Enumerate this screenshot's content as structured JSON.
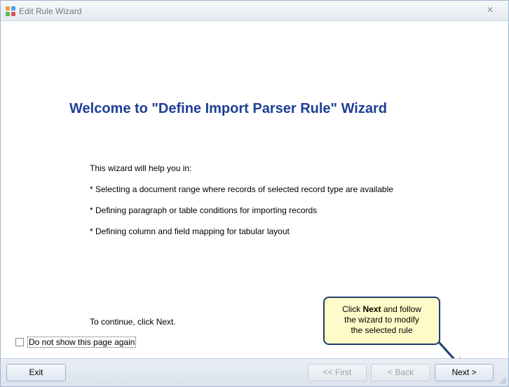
{
  "window": {
    "title": "Edit Rule Wizard",
    "close_glyph": "×"
  },
  "content": {
    "heading": "Welcome to \"Define Import Parser Rule\" Wizard",
    "intro": "This wizard will help you in:",
    "bullets": [
      "* Selecting a document range where records of selected record type are available",
      "* Defining paragraph or table conditions for importing records",
      "* Defining column and field mapping for tabular layout"
    ],
    "continue_text": "To continue, click Next.",
    "checkbox_label": "Do not show this page again"
  },
  "callout": {
    "line1_pre": "Click ",
    "line1_bold": "Next",
    "line1_post": " and follow",
    "line2": "the wizard to modify",
    "line3": "the selected rule"
  },
  "footer": {
    "exit_label": "Exit",
    "first_label": "<< First",
    "back_label": "< Back",
    "next_label": "Next >"
  },
  "colors": {
    "heading": "#1d3f95",
    "callout_bg": "#fffbc8",
    "callout_border": "#1f3c6e"
  },
  "icons": [
    "app-icon",
    "close-icon",
    "callout-arrow-icon",
    "resize-grip-icon"
  ]
}
